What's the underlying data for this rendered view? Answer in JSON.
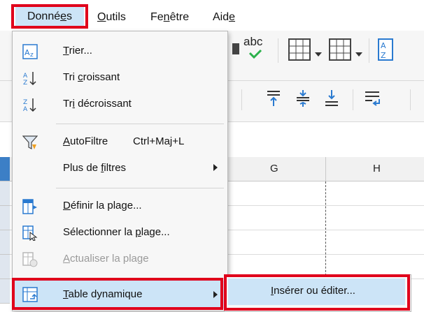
{
  "menubar": {
    "items": [
      {
        "pre": "Donné",
        "u": "e",
        "post": "s"
      },
      {
        "pre": "",
        "u": "O",
        "post": "utils"
      },
      {
        "pre": "Fe",
        "u": "n",
        "post": "être"
      },
      {
        "pre": "Aid",
        "u": "e",
        "post": ""
      }
    ]
  },
  "toolbar": {
    "spellcheck_text": "abc"
  },
  "columns": [
    "G",
    "H"
  ],
  "menu": {
    "items": [
      {
        "pre": "",
        "u": "T",
        "post": "rier...",
        "icon": "sort-icon"
      },
      {
        "pre": "Tri ",
        "u": "c",
        "post": "roissant",
        "icon": "sort-ascending-icon"
      },
      {
        "pre": "Tr",
        "u": "i",
        "post": " décroissant",
        "icon": "sort-descending-icon"
      },
      {
        "pre": "",
        "u": "A",
        "post": "utoFiltre",
        "shortcut": "Ctrl+Maj+L",
        "icon": "autofilter-icon"
      },
      {
        "pre": "Plus de ",
        "u": "f",
        "post": "iltres"
      },
      {
        "pre": "",
        "u": "D",
        "post": "éfinir la plage...",
        "icon": "define-range-icon"
      },
      {
        "pre": "Sélectionner la ",
        "u": "p",
        "post": "lage...",
        "icon": "select-range-icon"
      },
      {
        "pre": "",
        "u": "A",
        "post": "ctualiser la plage",
        "icon": "refresh-range-icon"
      },
      {
        "pre": "",
        "u": "T",
        "post": "able dynamique",
        "icon": "pivot-table-icon"
      }
    ]
  },
  "submenu": {
    "item": {
      "pre": "",
      "u": "I",
      "post": "nsérer ou éditer..."
    }
  },
  "colors": {
    "highlight": "#cce4f7",
    "annotation_red": "#e0001b",
    "selected_row": "#3c7fc6"
  }
}
